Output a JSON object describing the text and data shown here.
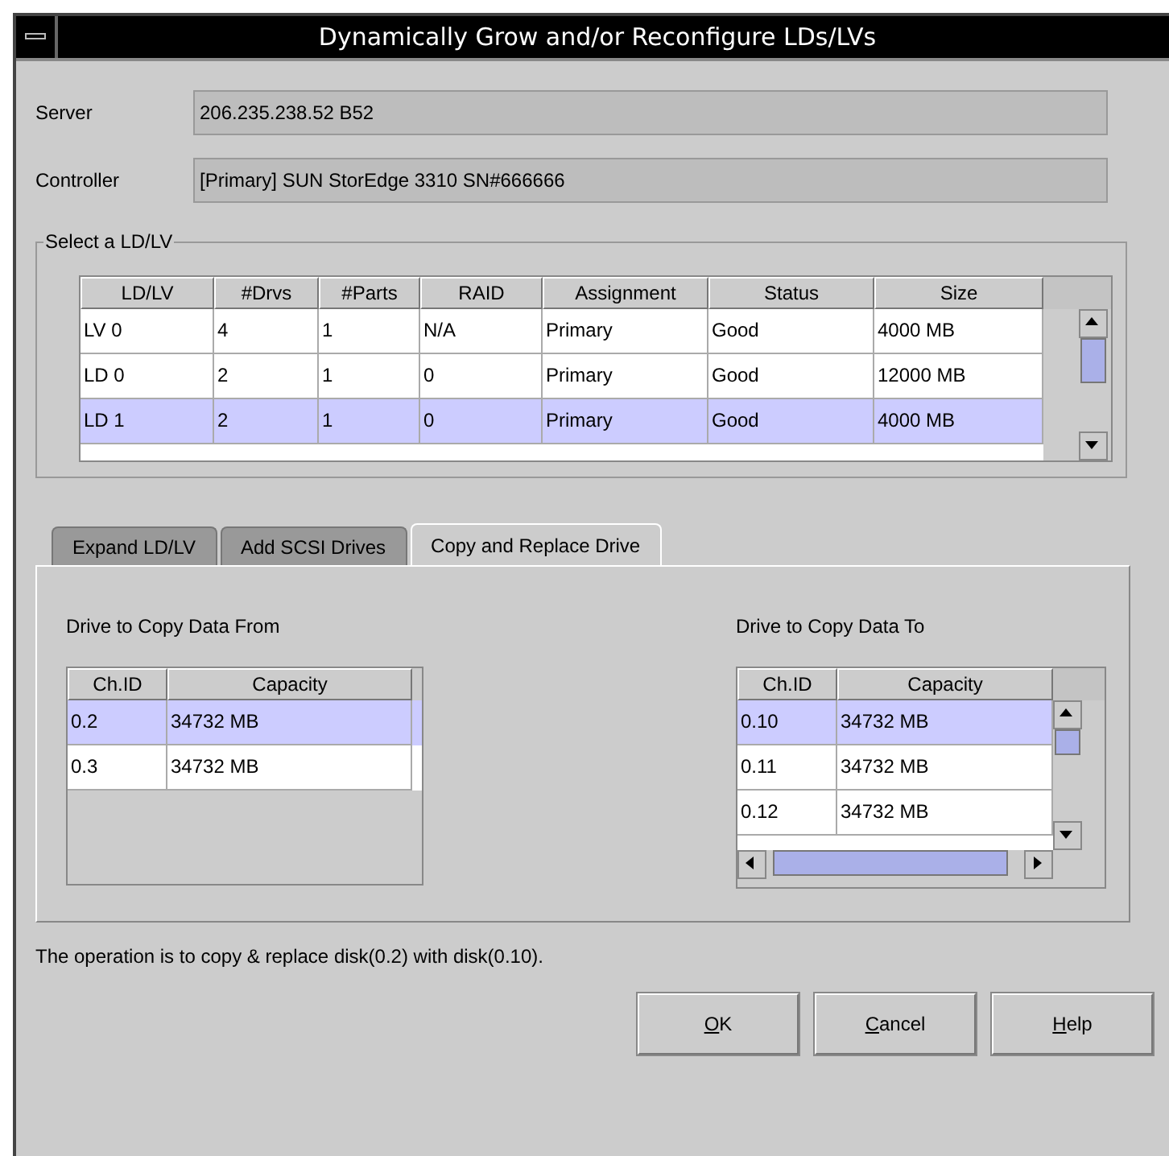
{
  "window": {
    "title": "Dynamically Grow and/or Reconfigure LDs/LVs"
  },
  "fields": [
    {
      "label": "Server",
      "value": "206.235.238.52 B52"
    },
    {
      "label": "Controller",
      "value": "[Primary] SUN StorEdge 3310 SN#666666"
    }
  ],
  "ld_table": {
    "title": "Select a LD/LV",
    "columns": [
      "LD/LV",
      "#Drvs",
      "#Parts",
      "RAID",
      "Assignment",
      "Status",
      "Size"
    ],
    "rows": [
      {
        "cells": [
          "LV 0",
          "4",
          "1",
          "N/A",
          "Primary",
          "Good",
          "4000 MB"
        ],
        "selected": false
      },
      {
        "cells": [
          "LD 0",
          "2",
          "1",
          "0",
          "Primary",
          "Good",
          "12000 MB"
        ],
        "selected": false
      },
      {
        "cells": [
          "LD 1",
          "2",
          "1",
          "0",
          "Primary",
          "Good",
          "4000 MB"
        ],
        "selected": true
      }
    ]
  },
  "tabs": [
    {
      "label": "Expand LD/LV",
      "selected": false
    },
    {
      "label": "Add SCSI Drives",
      "selected": false
    },
    {
      "label": "Copy and Replace Drive",
      "selected": true
    }
  ],
  "from_table": {
    "title": "Drive to Copy Data From",
    "columns": [
      "Ch.ID",
      "Capacity"
    ],
    "rows": [
      {
        "cells": [
          "0.2",
          "34732 MB"
        ],
        "selected": true
      },
      {
        "cells": [
          "0.3",
          "34732 MB"
        ],
        "selected": false
      }
    ]
  },
  "to_table": {
    "title": "Drive to Copy Data To",
    "columns": [
      "Ch.ID",
      "Capacity"
    ],
    "rows": [
      {
        "cells": [
          "0.10",
          "34732 MB"
        ],
        "selected": true
      },
      {
        "cells": [
          "0.11",
          "34732 MB"
        ],
        "selected": false
      },
      {
        "cells": [
          "0.12",
          "34732 MB"
        ],
        "selected": false
      }
    ]
  },
  "message": "The operation is to copy & replace disk(0.2) with disk(0.10).",
  "buttons": [
    {
      "label": "OK",
      "mnemonic_underlined": true
    },
    {
      "label": "Cancel",
      "mnemonic_underlined": true
    },
    {
      "label": "Help",
      "mnemonic_underlined": true
    }
  ]
}
